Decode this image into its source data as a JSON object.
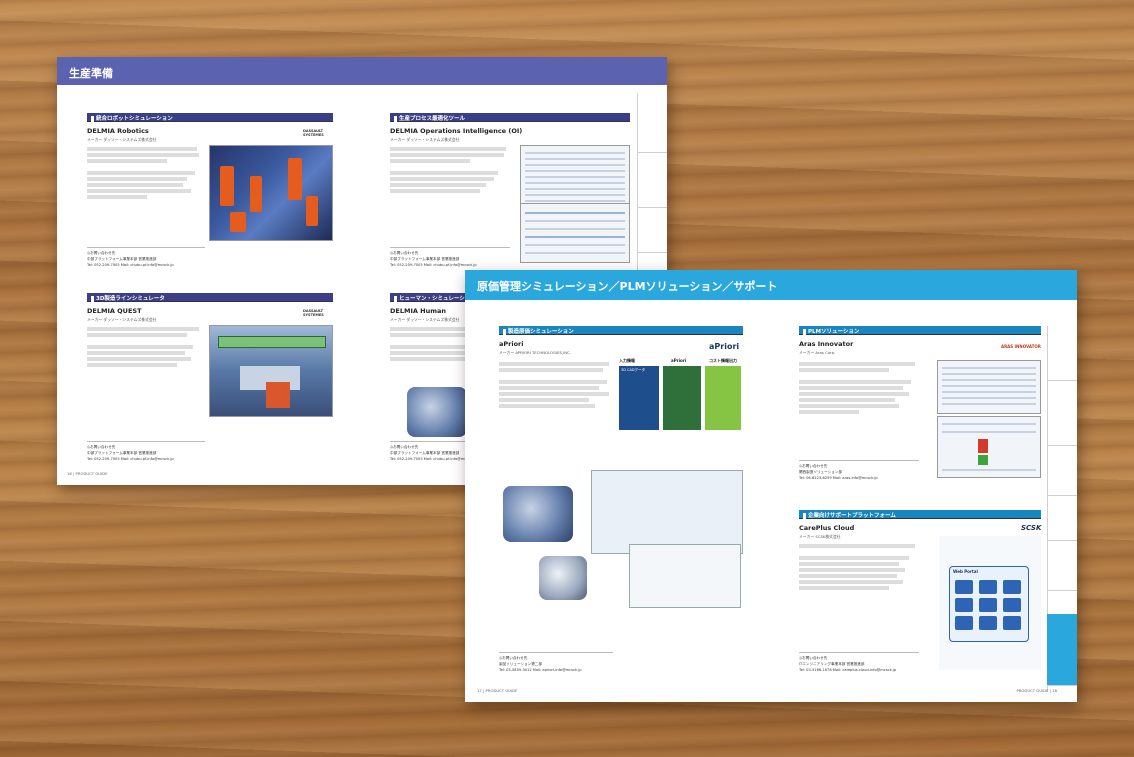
{
  "left_page": {
    "header_title": "生産準備",
    "sections": [
      {
        "title": "統合ロボットシミュレーション",
        "product": "DELMIA Robotics",
        "maker": "メーカー ダッソー・システムズ株式会社",
        "logo": "DASSAULT SYSTEMES",
        "contact_label": "◎お問い合わせ先",
        "contact_dept": "中部プラットフォーム事業本部 営業推進部",
        "contact_tel": "Tel: 052-209-7005 Mail: chubu-pf-info@mcsck.jp"
      },
      {
        "title": "生産プロセス最適化ツール",
        "product": "DELMIA Operations Intelligence (OI)",
        "maker": "メーカー ダッソー・システムズ株式会社",
        "logo": "DASSAULT SYSTEMES",
        "contact_label": "◎お問い合わせ先",
        "contact_dept": "中部プラットフォーム事業本部 営業推進部",
        "contact_tel": "Tel: 052-209-7005 Mail: chubu-pf-info@mcsck.jp"
      },
      {
        "title": "3D製造ラインシミュレータ",
        "product": "DELMIA QUEST",
        "maker": "メーカー ダッソー・システムズ株式会社",
        "logo": "DASSAULT SYSTEMES",
        "contact_label": "◎お問い合わせ先",
        "contact_dept": "中部プラットフォーム事業本部 営業推進部",
        "contact_tel": "Tel: 052-209-7005 Mail: chubu-pf-info@mcsck.jp"
      },
      {
        "title": "ヒューマン・シミュレーション",
        "product": "DELMIA Human",
        "maker": "メーカー ダッソー・システムズ株式会社",
        "logo": "DASSAULT SYSTEMES",
        "contact_label": "◎お問い合わせ先",
        "contact_dept": "中部プラットフォーム事業本部 営業推進部",
        "contact_tel": "Tel: 052-209-7005 Mail: chubu-pf-info@mcsck.jp"
      }
    ],
    "footer": "16 | PRODUCT GUIDE"
  },
  "right_page": {
    "header_title": "原価管理シミュレーション／PLMソリューション／サポート",
    "sections": [
      {
        "title": "製造原価シミュレーション",
        "product": "aPriori",
        "maker": "メーカー APRIORI TECHNOLOGIES,INC.",
        "logo": "aPriori",
        "diagram_labels": [
          "入力情報",
          "aPriori",
          "コスト情報出力",
          "3D CADデータ"
        ],
        "contact_label": "◎お問い合わせ先",
        "contact_dept": "製品ソリューション第二部",
        "contact_tel": "Tel: 03-5859-3012 Mail: apriori-info@mcsck.jp"
      },
      {
        "title": "PLMソリューション",
        "product": "Aras Innovator",
        "maker": "メーカー Aras Corp.",
        "logo": "ARAS INNOVATOR",
        "contact_label": "◎お問い合わせ先",
        "contact_dept": "関西製造ソリューション部",
        "contact_tel": "Tel: 06-6223-6259 Mail: aras-info@mcsck.jp"
      },
      {
        "title": "企業向けサポートプラットフォーム",
        "product": "CarePlus Cloud",
        "maker": "メーカー SCSK株式会社",
        "logo": "SCSK",
        "portal_label": "Web Portal",
        "contact_label": "◎お問い合わせ先",
        "contact_dept": "ITエンジニアリング事業本部 営業推進部",
        "contact_tel": "Tel: 03-5166-1678 Mail: careplus-cloud-info@mcsck.jp"
      }
    ],
    "footer_left": "17 | PRODUCT GUIDE",
    "footer_right": "PRODUCT GUIDE | 18"
  },
  "colors": {
    "left_header": "#5b62b0",
    "right_header": "#2aa7dc",
    "wood": "#b07a44"
  }
}
